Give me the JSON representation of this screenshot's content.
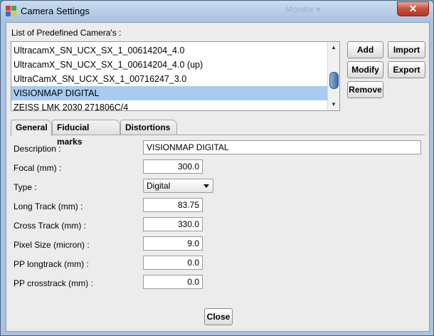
{
  "window": {
    "title": "Camera Settings",
    "close_glyph": "✕",
    "ghost_text": "Monitor ▾"
  },
  "list": {
    "label": "List of Predefined Camera's :",
    "items": [
      "UltracamX_SN_UCX_SX_1_00614204_4.0",
      "UltracamX_SN_UCX_SX_1_00614204_4.0 (up)",
      "UltraCamX_SN_UCX_SX_1_00716247_3.0",
      "VISIONMAP DIGITAL",
      "ZEISS LMK 2030 271806C/4"
    ],
    "selected_index": 3
  },
  "buttons": {
    "add": "Add",
    "import": "Import",
    "modify": "Modify",
    "export": "Export",
    "remove": "Remove",
    "close": "Close"
  },
  "tabs": [
    "General",
    "Fiducial marks",
    "Distortions"
  ],
  "active_tab": "General",
  "form": {
    "description_label": "Description :",
    "description_value": "VISIONMAP DIGITAL",
    "focal_label": "Focal (mm) :",
    "focal_value": "300.0",
    "type_label": "Type :",
    "type_value": "Digital",
    "long_track_label": "Long Track (mm) :",
    "long_track_value": "83.75",
    "cross_track_label": "Cross Track (mm) :",
    "cross_track_value": "330.0",
    "pixel_size_label": "Pixel Size (micron) :",
    "pixel_size_value": "9.0",
    "pp_longtrack_label": "PP longtrack (mm) :",
    "pp_longtrack_value": "0.0",
    "pp_crosstrack_label": "PP crosstrack (mm) :",
    "pp_crosstrack_value": "0.0"
  }
}
